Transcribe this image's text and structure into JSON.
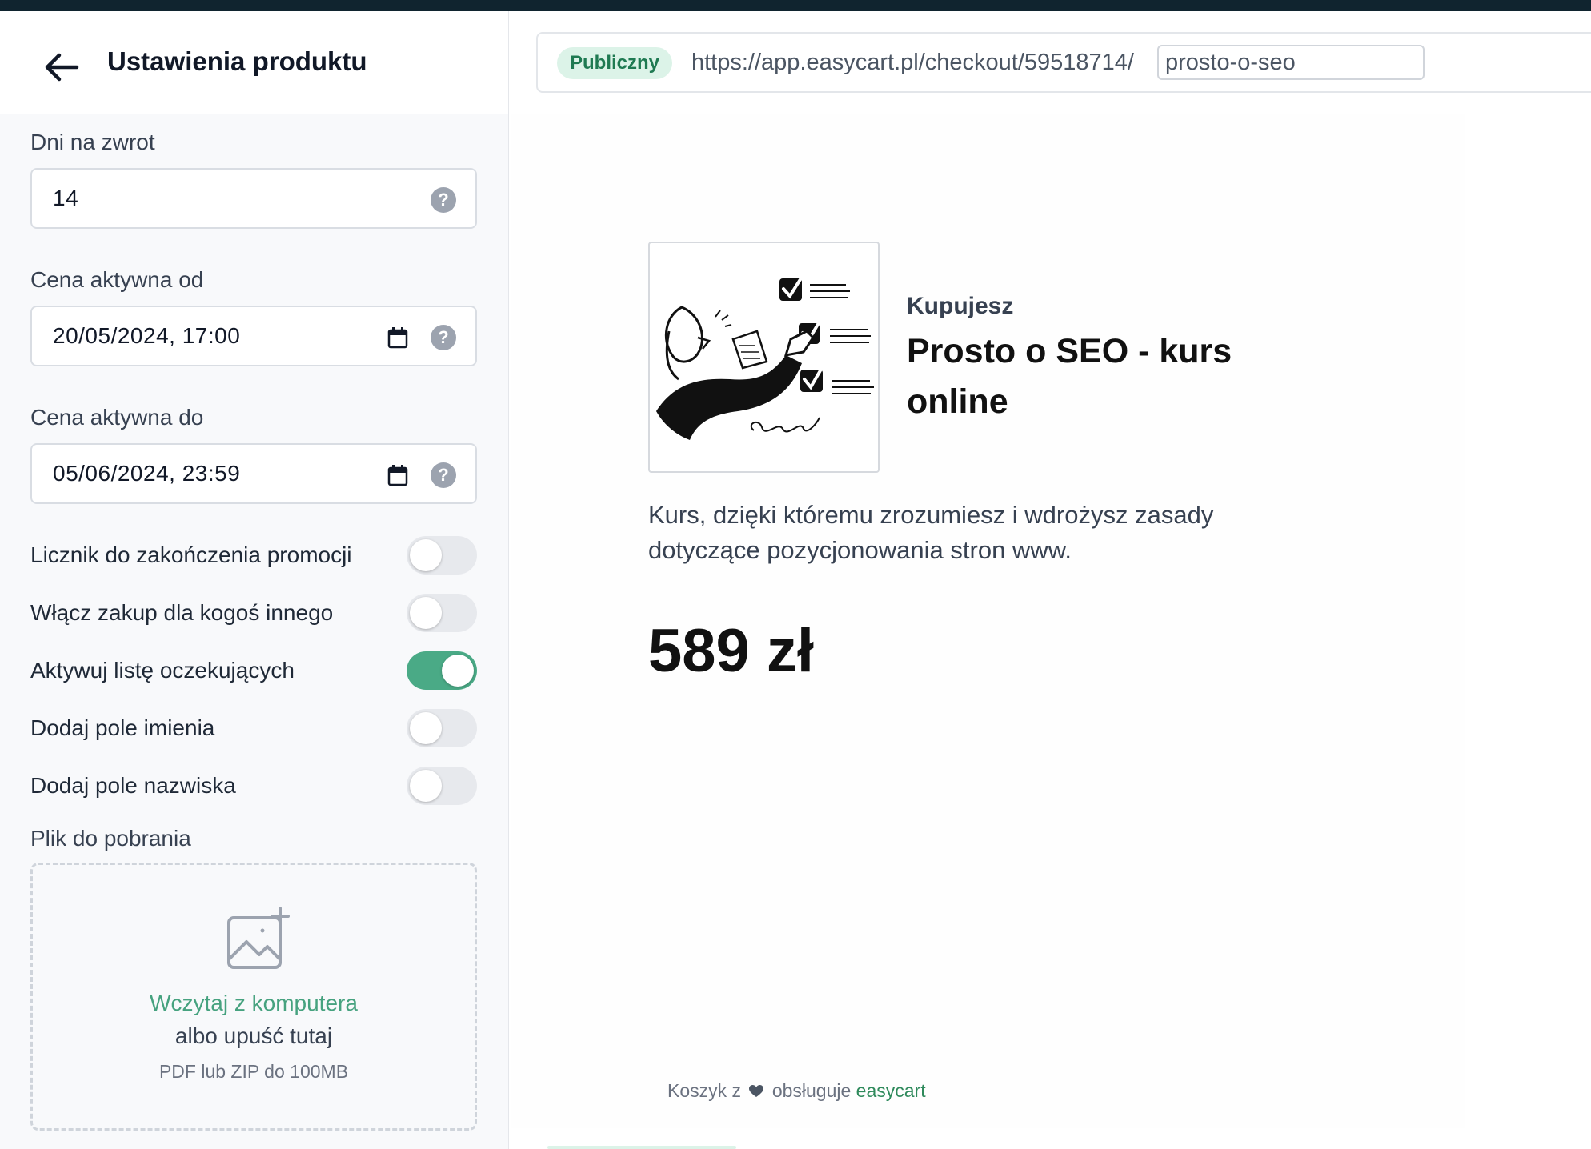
{
  "header": {
    "title": "Ustawienia produktu"
  },
  "settings": {
    "return_days": {
      "label": "Dni na zwrot",
      "value": "14"
    },
    "price_from": {
      "label": "Cena aktywna od",
      "value": "20/05/2024, 17:00"
    },
    "price_to": {
      "label": "Cena aktywna do",
      "value": "05/06/2024, 23:59"
    },
    "toggles": [
      {
        "label": "Licznik do zakończenia promocji",
        "on": false
      },
      {
        "label": "Włącz zakup dla kogoś innego",
        "on": false
      },
      {
        "label": "Aktywuj listę oczekujących",
        "on": true
      },
      {
        "label": "Dodaj pole imienia",
        "on": false
      },
      {
        "label": "Dodaj pole nazwiska",
        "on": false
      }
    ],
    "download": {
      "label": "Plik do pobrania",
      "link_text": "Wczytaj z komputera",
      "drop_text": "albo upuść tutaj",
      "hint": "PDF lub ZIP do 100MB"
    }
  },
  "url_bar": {
    "status": "Publiczny",
    "prefix": "https://app.easycart.pl/checkout/59518714/",
    "slug": "prosto-o-seo"
  },
  "preview": {
    "kicker": "Kupujesz",
    "product_title": "Prosto o SEO - kurs online",
    "description": "Kurs, dzięki któremu zrozumiesz i wdrożysz zasady dotyczące pozycjonowania stron www.",
    "price": "589 zł",
    "footer_before": "Koszyk z",
    "footer_after": "obsługuje",
    "footer_brand": "easycart"
  },
  "colors": {
    "accent": "#4aaa86",
    "status_bg": "#dcf3e8",
    "status_text": "#1f7a52",
    "top_bar": "#10242f"
  },
  "icons": {
    "back": "arrow-left-icon",
    "help": "question-circle-icon",
    "calendar": "calendar-icon",
    "upload": "image-plus-icon",
    "heart": "heart-icon"
  }
}
